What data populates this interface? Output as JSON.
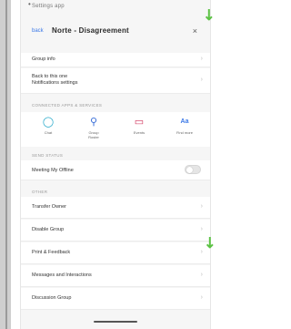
{
  "status": {
    "text": "Settings app"
  },
  "header": {
    "back_label": "back",
    "title": "Norte - Disagreement",
    "close_icon": "close-icon"
  },
  "rows_top": [
    {
      "label": "Group info"
    },
    {
      "label": "Back to this one\nNotifications settings"
    }
  ],
  "apps_section": {
    "header": "CONNECTED APPS & SERVICES",
    "apps": [
      {
        "label": "Chat",
        "icon": "ring-icon",
        "color": "#22a7c9"
      },
      {
        "label": "Group\nRoster",
        "icon": "tree-icon",
        "color": "#3a6fd8"
      },
      {
        "label": "Events",
        "icon": "card-icon",
        "color": "#d0315a"
      },
      {
        "label": "Find more",
        "icon": "text-icon",
        "color": "#3b78e7"
      }
    ]
  },
  "status_section": {
    "header": "SEND STATUS",
    "row_label": "Meeting My Offline"
  },
  "other_section": {
    "header": "OTHER",
    "rows": [
      {
        "label": "Transfer Owner"
      },
      {
        "label": "Disable Group"
      },
      {
        "label": "Print & Feedback"
      },
      {
        "label": "Messages and Interactions"
      },
      {
        "label": "Discussion Group"
      }
    ]
  },
  "colors": {
    "accent": "#3b78e7",
    "annotation_arrow": "#5cc244"
  }
}
